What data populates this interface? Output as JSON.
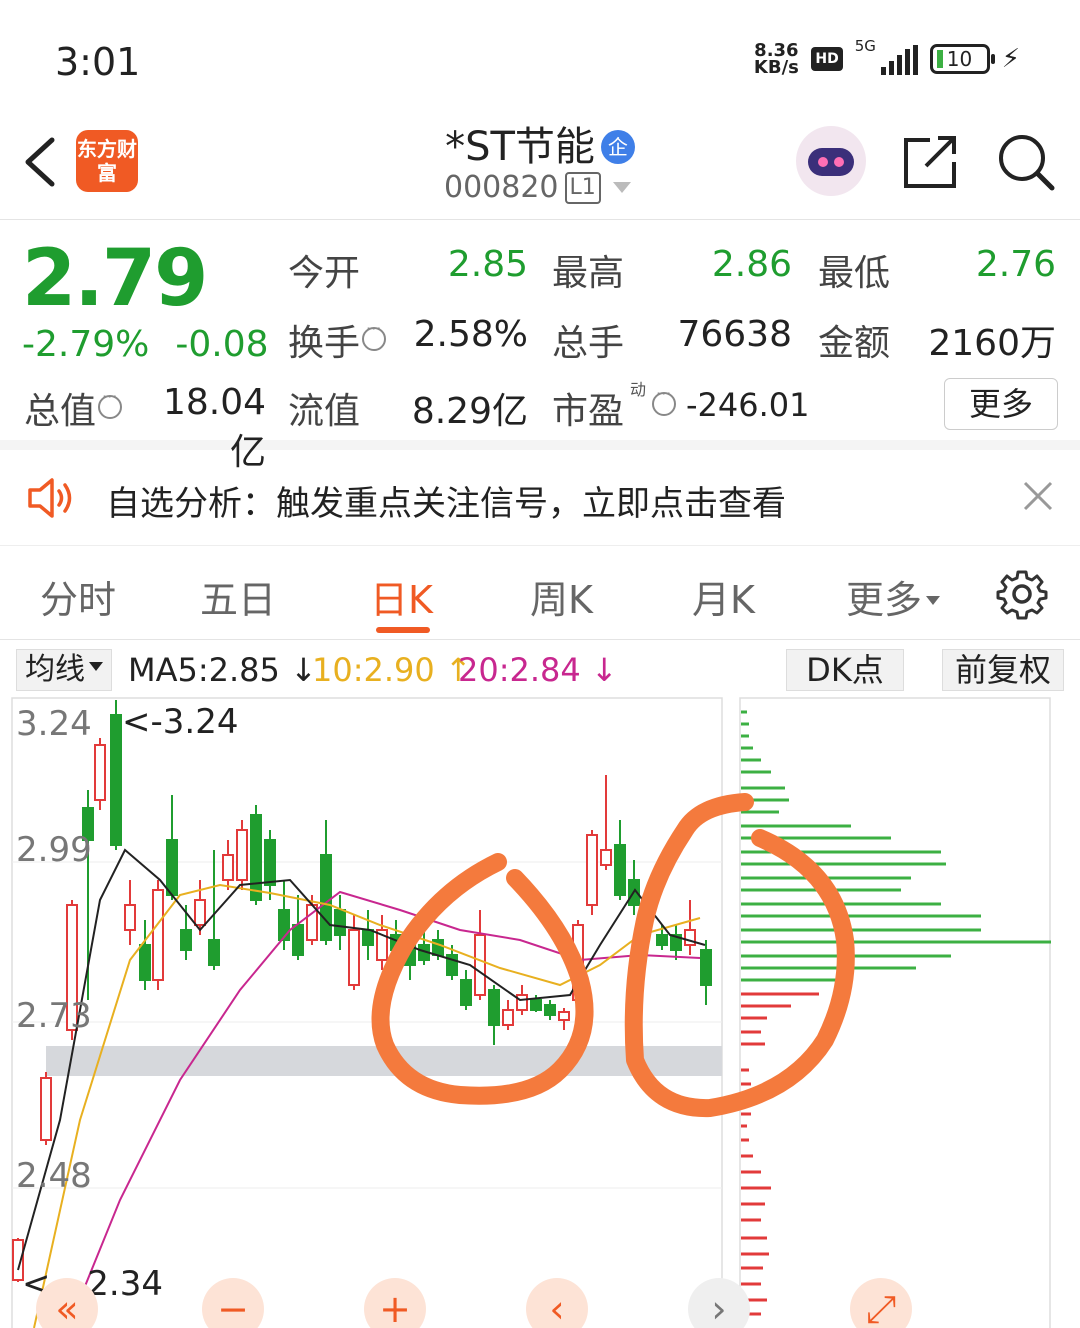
{
  "status": {
    "time": "3:01",
    "net_speed_value": "8.36",
    "net_speed_unit": "KB/s",
    "hd": "HD",
    "network": "5G",
    "battery": "10"
  },
  "header": {
    "logo_text": "东方财富",
    "stock_name": "*ST节能",
    "qi_badge": "企",
    "stock_code": "000820",
    "level_badge": "L1"
  },
  "quote": {
    "price": "2.79",
    "change_pct": "-2.79%",
    "change_abs": "-0.08",
    "open_label": "今开",
    "open_value": "2.85",
    "high_label": "最高",
    "high_value": "2.86",
    "low_label": "最低",
    "low_value": "2.76",
    "turnover_label": "换手",
    "turnover_value": "2.58%",
    "volume_label": "总手",
    "volume_value": "76638",
    "amount_label": "金额",
    "amount_value": "2160万",
    "mktcap_label": "总值",
    "mktcap_value": "18.04亿",
    "float_label": "流值",
    "float_value": "8.29亿",
    "pe_label": "市盈",
    "pe_superscript": "动",
    "pe_value": "-246.01",
    "more_button": "更多"
  },
  "notice": {
    "text": "自选分析：触发重点关注信号，立即点击查看"
  },
  "tabs": [
    {
      "label": "分时"
    },
    {
      "label": "五日"
    },
    {
      "label": "日K"
    },
    {
      "label": "周K"
    },
    {
      "label": "月K"
    },
    {
      "label": "更多"
    }
  ],
  "ma_bar": {
    "select": "均线",
    "ma5": "MA5:2.85",
    "ma10": "10:2.90",
    "ma20": "20:2.84",
    "dk_select": "DK点",
    "adjust_select": "前复权",
    "colors": {
      "ma5": "#222222",
      "ma10": "#e8b020",
      "ma20": "#c8278f"
    }
  },
  "chart": {
    "price_labels": [
      "3.24",
      "2.99",
      "2.73",
      "2.48"
    ],
    "high_mark": "<-3.24",
    "low_mark": "<---2.34",
    "up_color": "#e23a3a",
    "down_color": "#1f9d2f"
  },
  "chart_data": {
    "type": "candlestick",
    "y_ticks": [
      3.24,
      2.99,
      2.73,
      2.48
    ],
    "max_marker": 3.24,
    "min_marker": 2.34,
    "last_price": 2.79
  },
  "controls": {
    "zoom_out": "−",
    "zoom_in": "+",
    "prev": "‹",
    "next": "›"
  }
}
